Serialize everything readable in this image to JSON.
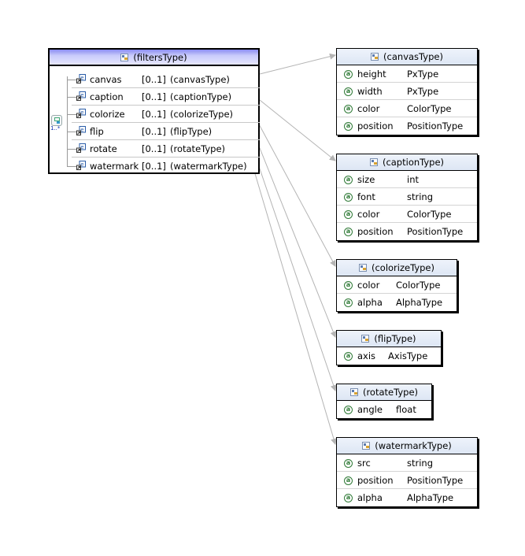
{
  "root": {
    "title": "(filtersType)",
    "icon": "complex-type-icon",
    "compositor": {
      "icon": "sequence-icon",
      "label": "1..*"
    },
    "elements": [
      {
        "name": "canvas",
        "cardinality": "[0..1]",
        "type": "(canvasType)",
        "icon": "element-icon"
      },
      {
        "name": "caption",
        "cardinality": "[0..1]",
        "type": "(captionType)",
        "icon": "element-icon"
      },
      {
        "name": "colorize",
        "cardinality": "[0..1]",
        "type": "(colorizeType)",
        "icon": "element-icon"
      },
      {
        "name": "flip",
        "cardinality": "[0..1]",
        "type": "(flipType)",
        "icon": "element-icon"
      },
      {
        "name": "rotate",
        "cardinality": "[0..1]",
        "type": "(rotateType)",
        "icon": "element-icon"
      },
      {
        "name": "watermark",
        "cardinality": "[0..1]",
        "type": "(watermarkType)",
        "icon": "element-icon"
      }
    ]
  },
  "types": [
    {
      "title": "(canvasType)",
      "attributes": [
        {
          "name": "height",
          "type": "PxType"
        },
        {
          "name": "width",
          "type": "PxType"
        },
        {
          "name": "color",
          "type": "ColorType"
        },
        {
          "name": "position",
          "type": "PositionType"
        }
      ]
    },
    {
      "title": "(captionType)",
      "attributes": [
        {
          "name": "size",
          "type": "int"
        },
        {
          "name": "font",
          "type": "string"
        },
        {
          "name": "color",
          "type": "ColorType"
        },
        {
          "name": "position",
          "type": "PositionType"
        }
      ]
    },
    {
      "title": "(colorizeType)",
      "attributes": [
        {
          "name": "color",
          "type": "ColorType"
        },
        {
          "name": "alpha",
          "type": "AlphaType"
        }
      ]
    },
    {
      "title": "(flipType)",
      "attributes": [
        {
          "name": "axis",
          "type": "AxisType"
        }
      ]
    },
    {
      "title": "(rotateType)",
      "attributes": [
        {
          "name": "angle",
          "type": "float"
        }
      ]
    },
    {
      "title": "(watermarkType)",
      "attributes": [
        {
          "name": "src",
          "type": "string"
        },
        {
          "name": "position",
          "type": "PositionType"
        },
        {
          "name": "alpha",
          "type": "AlphaType"
        }
      ]
    }
  ],
  "attribute_icon_glyph": "a",
  "colors": {
    "root_header": "#8a8cf0",
    "type_header": "#e3eaf6",
    "attribute_icon": "#2f7a36",
    "connector": "#b4b4b4"
  }
}
